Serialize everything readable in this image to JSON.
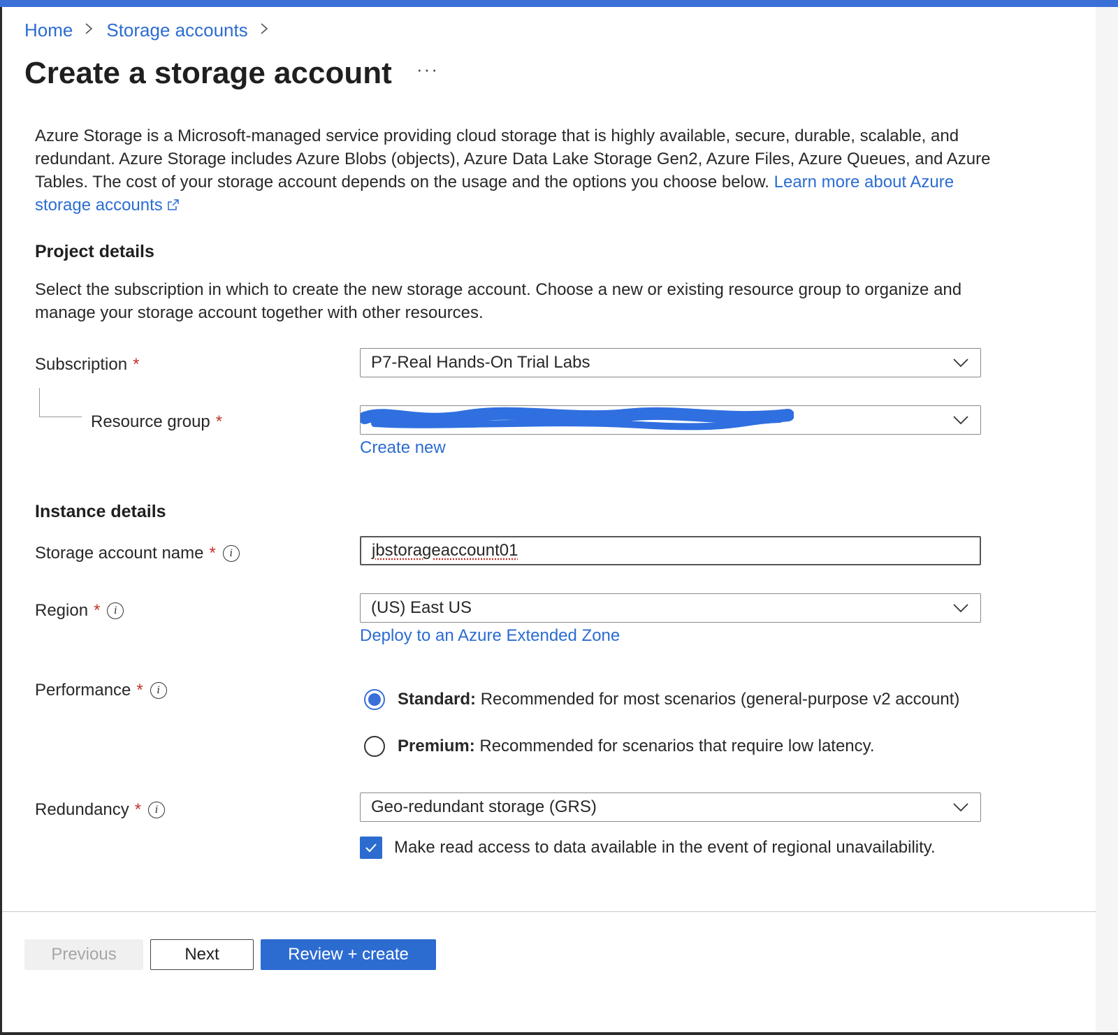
{
  "breadcrumb": {
    "home": "Home",
    "storage_accounts": "Storage accounts"
  },
  "page_title": "Create a storage account",
  "more_label": "···",
  "intro": {
    "text": "Azure Storage is a Microsoft-managed service providing cloud storage that is highly available, secure, durable, scalable, and redundant. Azure Storage includes Azure Blobs (objects), Azure Data Lake Storage Gen2, Azure Files, Azure Queues, and Azure Tables. The cost of your storage account depends on the usage and the options you choose below.",
    "link": "Learn more about Azure storage accounts"
  },
  "project_details": {
    "heading": "Project details",
    "description": "Select the subscription in which to create the new storage account. Choose a new or existing resource group to organize and manage your storage account together with other resources.",
    "subscription": {
      "label": "Subscription",
      "required": "*",
      "value": "P7-Real Hands-On Trial Labs"
    },
    "resource_group": {
      "label": "Resource group",
      "required": "*",
      "value": "",
      "create_new": "Create new"
    }
  },
  "instance_details": {
    "heading": "Instance details",
    "storage_account_name": {
      "label": "Storage account name",
      "required": "*",
      "value": "jbstorageaccount01"
    },
    "region": {
      "label": "Region",
      "required": "*",
      "value": "(US) East US",
      "extended_zone_link": "Deploy to an Azure Extended Zone"
    },
    "performance": {
      "label": "Performance",
      "required": "*",
      "options": [
        {
          "title": "Standard:",
          "description": "Recommended for most scenarios (general-purpose v2 account)",
          "selected": true
        },
        {
          "title": "Premium:",
          "description": "Recommended for scenarios that require low latency.",
          "selected": false
        }
      ]
    },
    "redundancy": {
      "label": "Redundancy",
      "required": "*",
      "value": "Geo-redundant storage (GRS)",
      "read_access_label": "Make read access to data available in the event of regional unavailability.",
      "read_access_checked": true
    }
  },
  "footer": {
    "previous": "Previous",
    "next": "Next",
    "review_create": "Review + create"
  },
  "colors": {
    "accent": "#2c6cd1",
    "required": "#c5332b",
    "redaction": "#2f6fe0"
  },
  "icons": {
    "dropdown": "chevron-down-icon",
    "info": "info-icon",
    "external": "external-link-icon",
    "check": "checkmark-icon"
  }
}
